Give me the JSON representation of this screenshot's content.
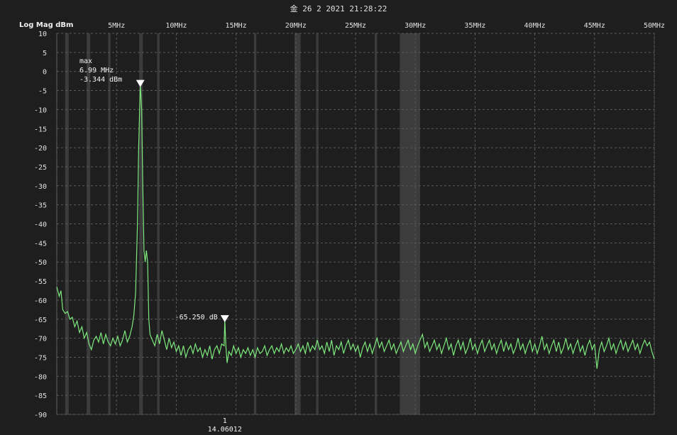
{
  "header": {
    "timestamp": "金 26 2 2021 21:28:22",
    "y_axis_title": "Log Mag dBm"
  },
  "chart_data": {
    "type": "line",
    "title": "",
    "xlabel": "",
    "ylabel": "Log Mag dBm",
    "xlim": [
      0,
      50
    ],
    "ylim": [
      -90,
      10
    ],
    "grid": true,
    "x_ticks": [
      {
        "value": 5,
        "label": "5MHz"
      },
      {
        "value": 10,
        "label": "10MHz"
      },
      {
        "value": 15,
        "label": "15MHz"
      },
      {
        "value": 20,
        "label": "20MHz"
      },
      {
        "value": 25,
        "label": "25MHz"
      },
      {
        "value": 30,
        "label": "30MHz"
      },
      {
        "value": 35,
        "label": "35MHz"
      },
      {
        "value": 40,
        "label": "40MHz"
      },
      {
        "value": 45,
        "label": "45MHz"
      },
      {
        "value": 50,
        "label": "50MHz"
      }
    ],
    "y_ticks": [
      10,
      5,
      0,
      -5,
      -10,
      -15,
      -20,
      -25,
      -30,
      -35,
      -40,
      -45,
      -50,
      -55,
      -60,
      -65,
      -70,
      -75,
      -80,
      -85,
      -90
    ],
    "line_color": "#7de87d",
    "background_color": "#1e1e1e",
    "band_color": "#3c3c3c",
    "highlight_bands": [
      {
        "from": 0.7,
        "to": 1.0
      },
      {
        "from": 2.5,
        "to": 2.8
      },
      {
        "from": 4.3,
        "to": 4.5
      },
      {
        "from": 6.9,
        "to": 7.2
      },
      {
        "from": 8.4,
        "to": 8.6
      },
      {
        "from": 16.5,
        "to": 16.7
      },
      {
        "from": 19.9,
        "to": 20.4
      },
      {
        "from": 21.7,
        "to": 21.9
      },
      {
        "from": 26.6,
        "to": 26.8
      },
      {
        "from": 28.7,
        "to": 30.4
      }
    ],
    "series": [
      {
        "values": [
          [
            0.0,
            -56.5
          ],
          [
            0.2,
            -59
          ],
          [
            0.35,
            -57.5
          ],
          [
            0.5,
            -62.5
          ],
          [
            0.7,
            -63.5
          ],
          [
            0.9,
            -63
          ],
          [
            1.1,
            -65
          ],
          [
            1.3,
            -64.5
          ],
          [
            1.5,
            -67
          ],
          [
            1.7,
            -65.5
          ],
          [
            1.9,
            -68.5
          ],
          [
            2.1,
            -67
          ],
          [
            2.3,
            -70
          ],
          [
            2.5,
            -68.5
          ],
          [
            2.7,
            -71.5
          ],
          [
            2.9,
            -73
          ],
          [
            3.1,
            -70.5
          ],
          [
            3.3,
            -69.5
          ],
          [
            3.5,
            -71
          ],
          [
            3.7,
            -68.5
          ],
          [
            3.9,
            -71.5
          ],
          [
            4.1,
            -69
          ],
          [
            4.3,
            -71
          ],
          [
            4.5,
            -72
          ],
          [
            4.7,
            -70
          ],
          [
            4.9,
            -71.5
          ],
          [
            5.1,
            -69.5
          ],
          [
            5.3,
            -72
          ],
          [
            5.5,
            -70.5
          ],
          [
            5.7,
            -68
          ],
          [
            5.9,
            -71
          ],
          [
            6.1,
            -69.5
          ],
          [
            6.3,
            -67
          ],
          [
            6.45,
            -64
          ],
          [
            6.6,
            -58
          ],
          [
            6.75,
            -40
          ],
          [
            6.85,
            -20
          ],
          [
            6.99,
            -3.344
          ],
          [
            7.1,
            -10
          ],
          [
            7.2,
            -30
          ],
          [
            7.3,
            -47
          ],
          [
            7.4,
            -50
          ],
          [
            7.5,
            -47
          ],
          [
            7.6,
            -50
          ],
          [
            7.7,
            -65
          ],
          [
            7.8,
            -69
          ],
          [
            8.0,
            -70.5
          ],
          [
            8.2,
            -72
          ],
          [
            8.4,
            -69
          ],
          [
            8.6,
            -71.5
          ],
          [
            8.8,
            -68
          ],
          [
            9.0,
            -70.5
          ],
          [
            9.2,
            -73
          ],
          [
            9.4,
            -70
          ],
          [
            9.6,
            -72.5
          ],
          [
            9.8,
            -71
          ],
          [
            10.0,
            -73.5
          ],
          [
            10.2,
            -72
          ],
          [
            10.4,
            -74.5
          ],
          [
            10.6,
            -72
          ],
          [
            10.8,
            -75
          ],
          [
            11.0,
            -73
          ],
          [
            11.2,
            -72
          ],
          [
            11.4,
            -74
          ],
          [
            11.6,
            -71.5
          ],
          [
            11.8,
            -73.5
          ],
          [
            12.0,
            -72.5
          ],
          [
            12.2,
            -75
          ],
          [
            12.4,
            -73
          ],
          [
            12.6,
            -74.5
          ],
          [
            12.8,
            -72
          ],
          [
            13.0,
            -75.5
          ],
          [
            13.2,
            -73
          ],
          [
            13.4,
            -72
          ],
          [
            13.6,
            -74
          ],
          [
            13.8,
            -71.5
          ],
          [
            14.0,
            -72
          ],
          [
            14.06,
            -65.25
          ],
          [
            14.15,
            -72
          ],
          [
            14.25,
            -76.5
          ],
          [
            14.4,
            -73.5
          ],
          [
            14.6,
            -74.5
          ],
          [
            14.8,
            -72
          ],
          [
            15.0,
            -74
          ],
          [
            15.2,
            -72.5
          ],
          [
            15.4,
            -75
          ],
          [
            15.6,
            -73
          ],
          [
            15.8,
            -74
          ],
          [
            16.0,
            -72.5
          ],
          [
            16.2,
            -74.5
          ],
          [
            16.4,
            -73
          ],
          [
            16.6,
            -75
          ],
          [
            16.8,
            -72.5
          ],
          [
            17.0,
            -74
          ],
          [
            17.2,
            -73.5
          ],
          [
            17.4,
            -72
          ],
          [
            17.6,
            -74.5
          ],
          [
            17.8,
            -73
          ],
          [
            18.0,
            -72
          ],
          [
            18.2,
            -74
          ],
          [
            18.4,
            -72.5
          ],
          [
            18.6,
            -73.5
          ],
          [
            18.8,
            -71.5
          ],
          [
            19.0,
            -74
          ],
          [
            19.2,
            -72.5
          ],
          [
            19.4,
            -73.5
          ],
          [
            19.6,
            -72
          ],
          [
            19.8,
            -74
          ],
          [
            20.0,
            -73
          ],
          [
            20.2,
            -71.5
          ],
          [
            20.4,
            -73.5
          ],
          [
            20.6,
            -72
          ],
          [
            20.8,
            -74
          ],
          [
            21.0,
            -71
          ],
          [
            21.2,
            -73.5
          ],
          [
            21.4,
            -72
          ],
          [
            21.6,
            -73
          ],
          [
            21.8,
            -70.5
          ],
          [
            22.0,
            -73
          ],
          [
            22.2,
            -72
          ],
          [
            22.4,
            -74
          ],
          [
            22.6,
            -71
          ],
          [
            22.8,
            -73.5
          ],
          [
            23.0,
            -70.5
          ],
          [
            23.2,
            -74.5
          ],
          [
            23.4,
            -72
          ],
          [
            23.6,
            -73
          ],
          [
            23.8,
            -71
          ],
          [
            24.0,
            -74
          ],
          [
            24.2,
            -72
          ],
          [
            24.4,
            -70.5
          ],
          [
            24.6,
            -73
          ],
          [
            24.8,
            -71.5
          ],
          [
            25.0,
            -73.5
          ],
          [
            25.2,
            -72
          ],
          [
            25.4,
            -75
          ],
          [
            25.6,
            -72.5
          ],
          [
            25.8,
            -71
          ],
          [
            26.0,
            -73.5
          ],
          [
            26.2,
            -71.5
          ],
          [
            26.4,
            -74
          ],
          [
            26.6,
            -72
          ],
          [
            26.8,
            -70
          ],
          [
            27.0,
            -72.5
          ],
          [
            27.2,
            -71
          ],
          [
            27.4,
            -73.5
          ],
          [
            27.6,
            -72
          ],
          [
            27.8,
            -70.5
          ],
          [
            28.0,
            -73
          ],
          [
            28.2,
            -71.5
          ],
          [
            28.4,
            -74
          ],
          [
            28.6,
            -72.5
          ],
          [
            28.8,
            -71
          ],
          [
            29.0,
            -73.5
          ],
          [
            29.2,
            -72
          ],
          [
            29.4,
            -70.5
          ],
          [
            29.6,
            -73
          ],
          [
            29.8,
            -71.5
          ],
          [
            30.0,
            -74
          ],
          [
            30.2,
            -72
          ],
          [
            30.4,
            -70.5
          ],
          [
            30.6,
            -69
          ],
          [
            30.8,
            -72.5
          ],
          [
            31.0,
            -71
          ],
          [
            31.2,
            -73.5
          ],
          [
            31.4,
            -72
          ],
          [
            31.6,
            -70.5
          ],
          [
            31.8,
            -73
          ],
          [
            32.0,
            -71.5
          ],
          [
            32.2,
            -74
          ],
          [
            32.4,
            -72
          ],
          [
            32.6,
            -70
          ],
          [
            32.8,
            -73
          ],
          [
            33.0,
            -71.5
          ],
          [
            33.2,
            -74.5
          ],
          [
            33.4,
            -72
          ],
          [
            33.6,
            -70.5
          ],
          [
            33.8,
            -73
          ],
          [
            34.0,
            -71
          ],
          [
            34.2,
            -74
          ],
          [
            34.4,
            -72.5
          ],
          [
            34.6,
            -70
          ],
          [
            34.8,
            -73
          ],
          [
            35.0,
            -71.5
          ],
          [
            35.2,
            -74
          ],
          [
            35.4,
            -72
          ],
          [
            35.6,
            -70.5
          ],
          [
            35.8,
            -73.5
          ],
          [
            36.0,
            -72
          ],
          [
            36.2,
            -70.5
          ],
          [
            36.4,
            -73
          ],
          [
            36.6,
            -71.5
          ],
          [
            36.8,
            -74
          ],
          [
            37.0,
            -72
          ],
          [
            37.2,
            -70.5
          ],
          [
            37.4,
            -73.5
          ],
          [
            37.6,
            -71
          ],
          [
            37.8,
            -73
          ],
          [
            38.0,
            -71.5
          ],
          [
            38.2,
            -74
          ],
          [
            38.4,
            -72.5
          ],
          [
            38.6,
            -70
          ],
          [
            38.8,
            -73
          ],
          [
            39.0,
            -71.5
          ],
          [
            39.2,
            -74
          ],
          [
            39.4,
            -72
          ],
          [
            39.6,
            -70.5
          ],
          [
            39.8,
            -73.5
          ],
          [
            40.0,
            -71.5
          ],
          [
            40.2,
            -74
          ],
          [
            40.4,
            -72
          ],
          [
            40.6,
            -69.5
          ],
          [
            40.8,
            -73
          ],
          [
            41.0,
            -71.5
          ],
          [
            41.2,
            -74
          ],
          [
            41.4,
            -72
          ],
          [
            41.6,
            -70.5
          ],
          [
            41.8,
            -73.5
          ],
          [
            42.0,
            -71
          ],
          [
            42.2,
            -74
          ],
          [
            42.4,
            -72.5
          ],
          [
            42.6,
            -70
          ],
          [
            42.8,
            -73
          ],
          [
            43.0,
            -71.5
          ],
          [
            43.2,
            -74
          ],
          [
            43.4,
            -72
          ],
          [
            43.6,
            -70.5
          ],
          [
            43.8,
            -73.5
          ],
          [
            44.0,
            -72
          ],
          [
            44.2,
            -74.5
          ],
          [
            44.4,
            -72
          ],
          [
            44.6,
            -70.5
          ],
          [
            44.8,
            -73
          ],
          [
            45.0,
            -71.5
          ],
          [
            45.2,
            -78
          ],
          [
            45.4,
            -73
          ],
          [
            45.6,
            -71
          ],
          [
            45.8,
            -73.5
          ],
          [
            46.0,
            -72
          ],
          [
            46.2,
            -70
          ],
          [
            46.4,
            -73
          ],
          [
            46.6,
            -71.5
          ],
          [
            46.8,
            -74
          ],
          [
            47.0,
            -72
          ],
          [
            47.2,
            -70.5
          ],
          [
            47.4,
            -73
          ],
          [
            47.6,
            -71
          ],
          [
            47.8,
            -73.5
          ],
          [
            48.0,
            -72
          ],
          [
            48.2,
            -70.5
          ],
          [
            48.4,
            -73
          ],
          [
            48.6,
            -71.5
          ],
          [
            48.8,
            -74
          ],
          [
            49.0,
            -72
          ],
          [
            49.2,
            -70.5
          ],
          [
            49.4,
            -72
          ],
          [
            49.6,
            -71
          ],
          [
            49.8,
            -73.5
          ],
          [
            50.0,
            -75.5
          ]
        ]
      }
    ],
    "markers": [
      {
        "x": 6.99,
        "y": -3.344,
        "lines": [
          "max",
          "6.99 MHz",
          "-3.344 dBm"
        ]
      },
      {
        "x": 14.06012,
        "y": -65.25,
        "label": "-65.250 dB",
        "index_label": "1",
        "freq_label": "14.06012"
      }
    ]
  }
}
